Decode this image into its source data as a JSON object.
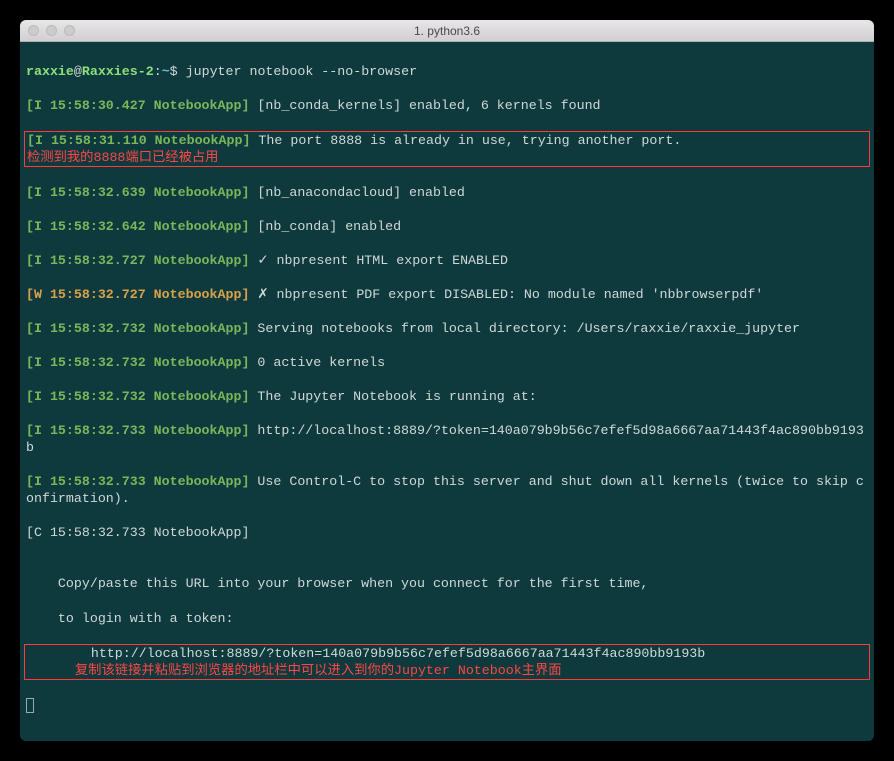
{
  "window": {
    "title": "1. python3.6"
  },
  "prompt": {
    "user": "raxxie",
    "at": "@",
    "host": "Raxxies-2",
    "sep": ":",
    "path": "~",
    "sign": "$ ",
    "command": "jupyter notebook --no-browser"
  },
  "logs": {
    "l1_tag": "[I 15:58:30.427 NotebookApp]",
    "l1_msg": " [nb_conda_kernels] enabled, 6 kernels found",
    "l2_tag": "[I 15:58:31.110 NotebookApp]",
    "l2_msg_a": " The port 8888 is already in use, trying another port.",
    "l2_anno": "检测到我的8888端口已经被占用",
    "l3_tag": "[I 15:58:32.639 NotebookApp]",
    "l3_msg": " [nb_anacondacloud] enabled",
    "l4_tag": "[I 15:58:32.642 NotebookApp]",
    "l4_msg": " [nb_conda] enabled",
    "l5_tag": "[I 15:58:32.727 NotebookApp]",
    "l5_msg": " ✓ nbpresent HTML export ENABLED",
    "l6_tag": "[W 15:58:32.727 NotebookApp]",
    "l6_msg": " ✗ nbpresent PDF export DISABLED: No module named 'nbbrowserpdf'",
    "l7_tag": "[I 15:58:32.732 NotebookApp]",
    "l7_msg": " Serving notebooks from local directory: /Users/raxxie/raxxie_jupyter",
    "l8_tag": "[I 15:58:32.732 NotebookApp]",
    "l8_msg": " 0 active kernels",
    "l9_tag": "[I 15:58:32.732 NotebookApp]",
    "l9_msg": " The Jupyter Notebook is running at:",
    "l10_tag": "[I 15:58:32.733 NotebookApp]",
    "l10_msg": " http://localhost:8889/?token=140a079b9b56c7efef5d98a6667aa71443f4ac890bb9193b",
    "l11_tag": "[I 15:58:32.733 NotebookApp]",
    "l11_msg": " Use Control-C to stop this server and shut down all kernels (twice to skip confirmation).",
    "l12_tag": "[C 15:58:32.733 NotebookApp]",
    "blank": "",
    "copy1": "    Copy/paste this URL into your browser when you connect for the first time,",
    "copy2": "    to login with a token:",
    "url": "        http://localhost:8889/?token=140a079b9b56c7efef5d98a6667aa71443f4ac890bb9193b",
    "url_anno": "复制该链接并粘贴到浏览器的地址栏中可以进入到你的Jupyter Notebook主界面"
  }
}
